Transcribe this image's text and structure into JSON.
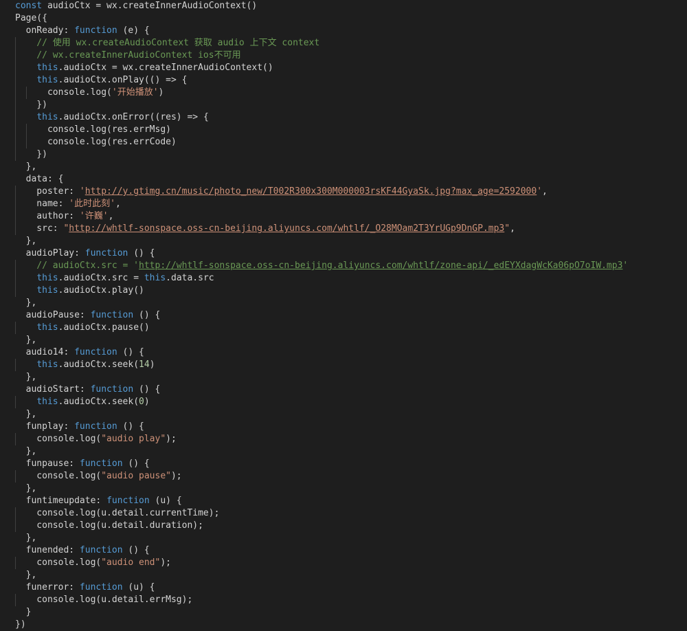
{
  "editor": {
    "colors": {
      "background": "#1e1e1e",
      "text": "#d4d4d4",
      "keyword": "#569cd6",
      "function": "#dcdcaa",
      "string": "#ce9178",
      "comment": "#6a9955",
      "number": "#b5cea8",
      "property": "#9cdcfe"
    },
    "lines": [
      [
        [
          "kw",
          "const"
        ],
        [
          "txt",
          " audioCtx = wx.createInnerAudioContext()"
        ]
      ],
      [
        [
          "txt",
          "Page({"
        ]
      ],
      [
        [
          "txt",
          "  onReady: "
        ],
        [
          "kw",
          "function"
        ],
        [
          "txt",
          " (e) {"
        ]
      ],
      [
        [
          "com",
          "    // 使用 wx.createAudioContext 获取 audio 上下文 context"
        ]
      ],
      [
        [
          "com",
          "    // wx.createInnerAudioContext ios不可用"
        ]
      ],
      [
        [
          "txt",
          "    "
        ],
        [
          "kw",
          "this"
        ],
        [
          "txt",
          ".audioCtx = wx.createInnerAudioContext()"
        ]
      ],
      [
        [
          "txt",
          "    "
        ],
        [
          "kw",
          "this"
        ],
        [
          "txt",
          ".audioCtx.onPlay(() => {"
        ]
      ],
      [
        [
          "txt",
          "      console.log("
        ],
        [
          "str",
          "'开始播放'"
        ],
        [
          "txt",
          ")"
        ]
      ],
      [
        [
          "txt",
          "    })"
        ]
      ],
      [
        [
          "txt",
          "    "
        ],
        [
          "kw",
          "this"
        ],
        [
          "txt",
          ".audioCtx.onError((res) => {"
        ]
      ],
      [
        [
          "txt",
          "      console.log(res.errMsg)"
        ]
      ],
      [
        [
          "txt",
          "      console.log(res.errCode)"
        ]
      ],
      [
        [
          "txt",
          "    })"
        ]
      ],
      [
        [
          "txt",
          "  },"
        ]
      ],
      [
        [
          "txt",
          "  data: {"
        ]
      ],
      [
        [
          "txt",
          "    poster: "
        ],
        [
          "str",
          "'"
        ],
        [
          "url",
          "http://y.gtimg.cn/music/photo_new/T002R300x300M000003rsKF44GyaSk.jpg?max_age=2592000"
        ],
        [
          "str",
          "'"
        ],
        [
          "txt",
          ","
        ]
      ],
      [
        [
          "txt",
          "    name: "
        ],
        [
          "str",
          "'此时此刻'"
        ],
        [
          "txt",
          ","
        ]
      ],
      [
        [
          "txt",
          "    author: "
        ],
        [
          "str",
          "'许巍'"
        ],
        [
          "txt",
          ","
        ]
      ],
      [
        [
          "txt",
          "    src: "
        ],
        [
          "str",
          "\""
        ],
        [
          "url",
          "http://whtlf-sonspace.oss-cn-beijing.aliyuncs.com/whtlf/_O28MOam2T3YrUGp9DnGP.mp3"
        ],
        [
          "str",
          "\""
        ],
        [
          "txt",
          ","
        ]
      ],
      [
        [
          "txt",
          "  },"
        ]
      ],
      [
        [
          "txt",
          "  audioPlay: "
        ],
        [
          "kw",
          "function"
        ],
        [
          "txt",
          " () {"
        ]
      ],
      [
        [
          "com",
          "    // audioCtx.src = '"
        ],
        [
          "comurl",
          "http://whtlf-sonspace.oss-cn-beijing.aliyuncs.com/whtlf/zone-api/_edEYXdagWcKa06pO7oIW.mp3"
        ],
        [
          "com",
          "'"
        ]
      ],
      [
        [
          "txt",
          "    "
        ],
        [
          "kw",
          "this"
        ],
        [
          "txt",
          ".audioCtx.src = "
        ],
        [
          "kw",
          "this"
        ],
        [
          "txt",
          ".data.src"
        ]
      ],
      [
        [
          "txt",
          "    "
        ],
        [
          "kw",
          "this"
        ],
        [
          "txt",
          ".audioCtx.play()"
        ]
      ],
      [
        [
          "txt",
          "  },"
        ]
      ],
      [
        [
          "txt",
          "  audioPause: "
        ],
        [
          "kw",
          "function"
        ],
        [
          "txt",
          " () {"
        ]
      ],
      [
        [
          "txt",
          "    "
        ],
        [
          "kw",
          "this"
        ],
        [
          "txt",
          ".audioCtx.pause()"
        ]
      ],
      [
        [
          "txt",
          "  },"
        ]
      ],
      [
        [
          "txt",
          "  audio14: "
        ],
        [
          "kw",
          "function"
        ],
        [
          "txt",
          " () {"
        ]
      ],
      [
        [
          "txt",
          "    "
        ],
        [
          "kw",
          "this"
        ],
        [
          "txt",
          ".audioCtx.seek("
        ],
        [
          "num",
          "14"
        ],
        [
          "txt",
          ")"
        ]
      ],
      [
        [
          "txt",
          "  },"
        ]
      ],
      [
        [
          "txt",
          "  audioStart: "
        ],
        [
          "kw",
          "function"
        ],
        [
          "txt",
          " () {"
        ]
      ],
      [
        [
          "txt",
          "    "
        ],
        [
          "kw",
          "this"
        ],
        [
          "txt",
          ".audioCtx.seek("
        ],
        [
          "num",
          "0"
        ],
        [
          "txt",
          ")"
        ]
      ],
      [
        [
          "txt",
          "  },"
        ]
      ],
      [
        [
          "txt",
          "  funplay: "
        ],
        [
          "kw",
          "function"
        ],
        [
          "txt",
          " () {"
        ]
      ],
      [
        [
          "txt",
          "    console.log("
        ],
        [
          "str",
          "\"audio play\""
        ],
        [
          "txt",
          ");"
        ]
      ],
      [
        [
          "txt",
          "  },"
        ]
      ],
      [
        [
          "txt",
          "  funpause: "
        ],
        [
          "kw",
          "function"
        ],
        [
          "txt",
          " () {"
        ]
      ],
      [
        [
          "txt",
          "    console.log("
        ],
        [
          "str",
          "\"audio pause\""
        ],
        [
          "txt",
          ");"
        ]
      ],
      [
        [
          "txt",
          "  },"
        ]
      ],
      [
        [
          "txt",
          "  funtimeupdate: "
        ],
        [
          "kw",
          "function"
        ],
        [
          "txt",
          " (u) {"
        ]
      ],
      [
        [
          "txt",
          "    console.log(u.detail.currentTime);"
        ]
      ],
      [
        [
          "txt",
          "    console.log(u.detail.duration);"
        ]
      ],
      [
        [
          "txt",
          "  },"
        ]
      ],
      [
        [
          "txt",
          "  funended: "
        ],
        [
          "kw",
          "function"
        ],
        [
          "txt",
          " () {"
        ]
      ],
      [
        [
          "txt",
          "    console.log("
        ],
        [
          "str",
          "\"audio end\""
        ],
        [
          "txt",
          ");"
        ]
      ],
      [
        [
          "txt",
          "  },"
        ]
      ],
      [
        [
          "txt",
          "  funerror: "
        ],
        [
          "kw",
          "function"
        ],
        [
          "txt",
          " (u) {"
        ]
      ],
      [
        [
          "txt",
          "    console.log(u.detail.errMsg);"
        ]
      ],
      [
        [
          "txt",
          "  }"
        ]
      ],
      [
        [
          "txt",
          "})"
        ]
      ]
    ]
  }
}
